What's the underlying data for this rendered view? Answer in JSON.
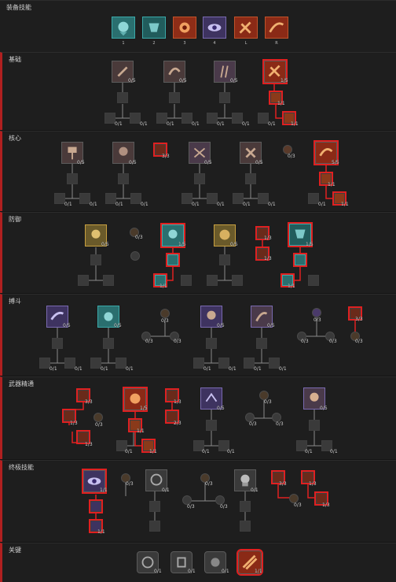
{
  "sections": {
    "equipped": {
      "title": "装备技能"
    },
    "basic": {
      "title": "基础"
    },
    "core": {
      "title": "核心"
    },
    "defense": {
      "title": "防御"
    },
    "brawl": {
      "title": "搏斗"
    },
    "weapon": {
      "title": "武器精通"
    },
    "ultimate": {
      "title": "终极技能"
    },
    "key": {
      "title": "关键"
    }
  },
  "hotbar": [
    {
      "key": "1",
      "icon": "shout-icon",
      "color": "#2e8b8b"
    },
    {
      "key": "2",
      "icon": "war-cry-icon",
      "color": "#2e7a7a"
    },
    {
      "key": "3",
      "icon": "rage-icon",
      "color": "#b5391e"
    },
    {
      "key": "4",
      "icon": "eye-icon",
      "color": "#5a4a8a"
    },
    {
      "key": "L",
      "icon": "weapon-icon",
      "color": "#a8391e"
    },
    {
      "key": "R",
      "icon": "slash-icon",
      "color": "#a8391e"
    }
  ],
  "counts": {
    "c05": "0/5",
    "c15": "1/5",
    "c55": "5/5",
    "c11": "1/1",
    "c01": "0/1",
    "c33": "3/3",
    "c03": "0/3",
    "c13": "1/3",
    "c23": "2/3"
  },
  "colors": {
    "accent": "#e02020",
    "teal": "#3aa8a8",
    "gold": "#c8a040",
    "purple": "#6a5aa8",
    "brown": "#8a6a5a"
  }
}
